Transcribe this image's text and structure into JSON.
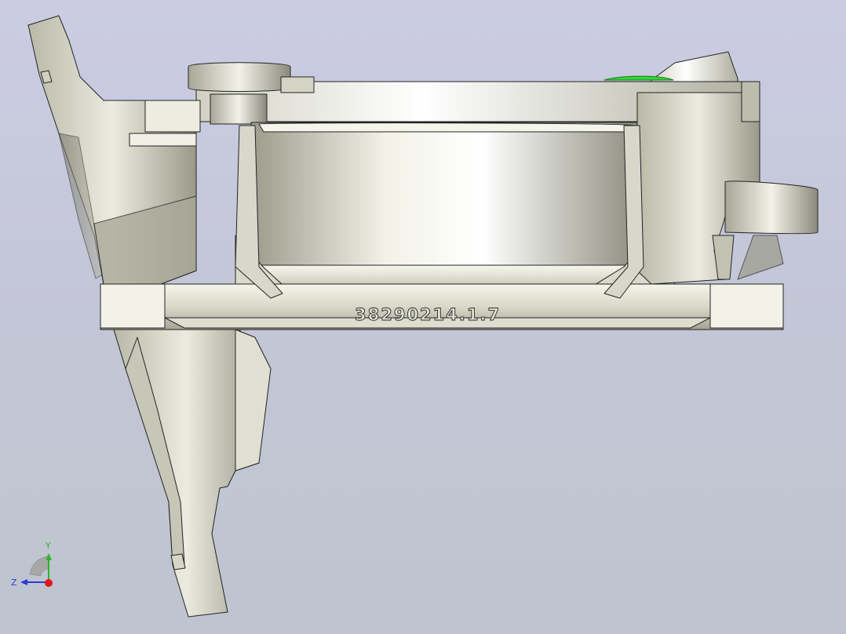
{
  "viewer": {
    "background_top": "#cbcce3",
    "background_bottom": "#bec5cf"
  },
  "model": {
    "material_color": "#e6e6d6",
    "edge_color": "#232323",
    "highlight_color": "#35d63a",
    "embossed_part_number": "38290214.1.7"
  },
  "axis_triad": {
    "y_label": "Y",
    "z_label": "Z",
    "y_axis_color": "#2db52d",
    "z_axis_color": "#2a39d9",
    "x_axis_color": "#e0181e",
    "icon": "axis-triad-icon"
  }
}
